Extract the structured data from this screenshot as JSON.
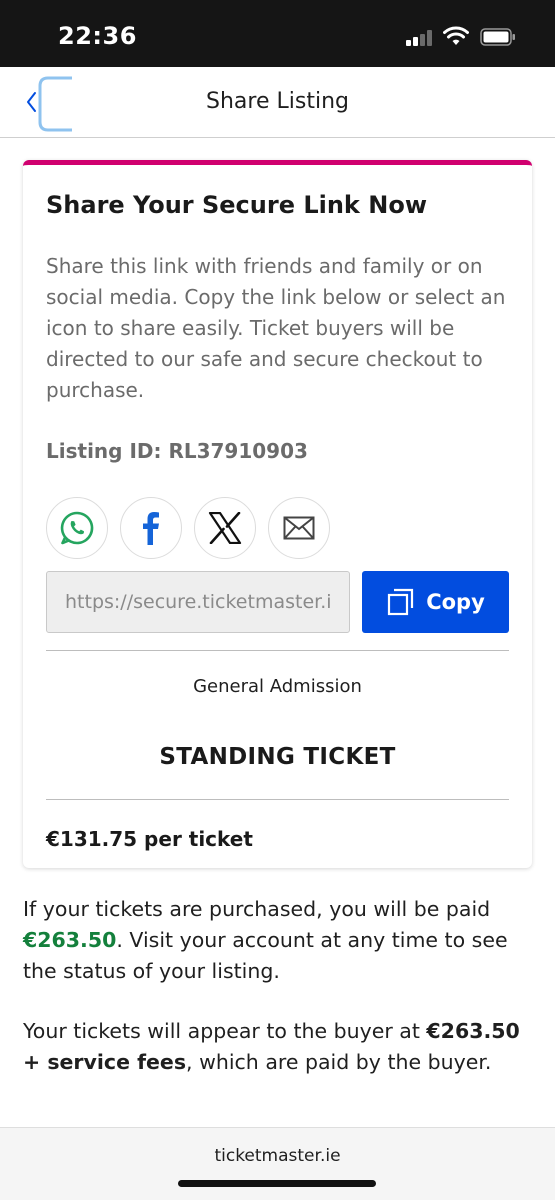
{
  "status_bar": {
    "time": "22:36",
    "icons": [
      "cellular-signal-icon",
      "wifi-icon",
      "battery-icon"
    ]
  },
  "header": {
    "title": "Share Listing",
    "back_icon": "chevron-left-icon"
  },
  "card": {
    "accent_color": "#d0006f",
    "title": "Share Your Secure Link Now",
    "description": "Share this link with friends and family or on social media. Copy the link below or select an icon to share easily. Ticket buyers will be directed to our safe and secure checkout to purchase.",
    "listing_id_label": "Listing ID: RL37910903",
    "share_icons": [
      "whatsapp-icon",
      "facebook-icon",
      "x-icon",
      "email-icon"
    ],
    "link_value": "https://secure.ticketmaster.ie",
    "copy_label": "Copy",
    "copy_color": "#024ddf",
    "ticket_area": "General Admission",
    "ticket_type": "STANDING TICKET",
    "price_per_ticket": "€131.75 per ticket"
  },
  "payout": {
    "text_before": "If your tickets are purchased, you will be paid ",
    "amount": "€263.50",
    "amount_color": "#14803c",
    "text_after": ". Visit your account at any time to see the status of your listing."
  },
  "buyer_price": {
    "text_before": "Your tickets will appear to the buyer at ",
    "amount": "€263.50 + service fees",
    "text_after": ", which are paid by the buyer."
  },
  "footer": {
    "site": "ticketmaster.ie"
  }
}
